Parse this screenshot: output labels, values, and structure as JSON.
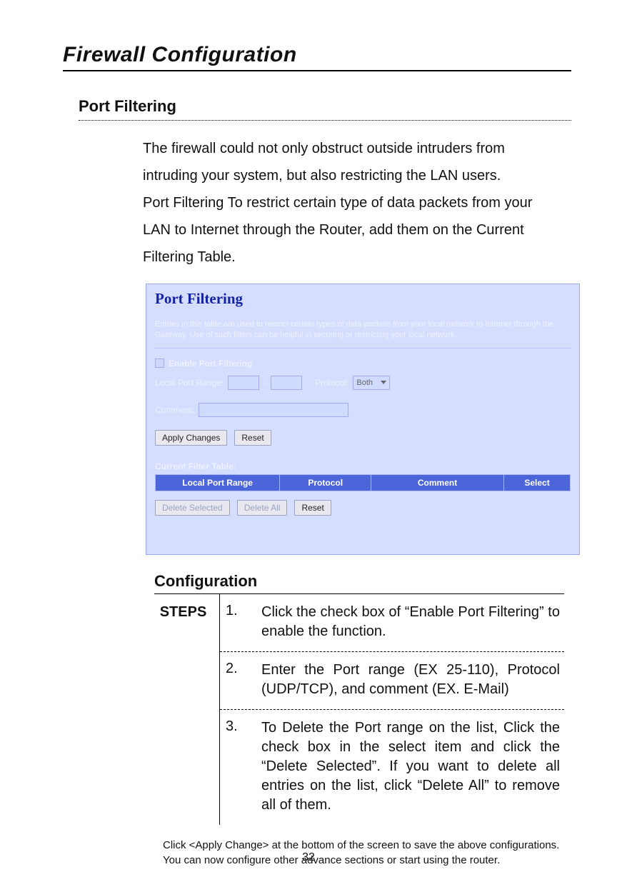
{
  "doc": {
    "title": "Firewall Configuration",
    "section": "Port Filtering",
    "paragraph1": "The firewall could not only obstruct outside intruders from intruding your system, but also restricting the LAN users.",
    "paragraph2": "Port Filtering To restrict certain type of data packets from your LAN to Internet through the Router, add them on the Current Filtering Table."
  },
  "shot": {
    "title": "Port Filtering",
    "description": "Entries in this table are used to restrict certain types of data packets from your local network to Internet through the Gateway. Use of such filters can be helpful in securing or restricting your local network.",
    "enable_label": "Enable Port Filtering",
    "port_range_label": "Local Port Range:",
    "protocol_label": "Protocol:",
    "protocol_value": "Both",
    "comment_label": "Comment:",
    "btn_apply": "Apply Changes",
    "btn_reset": "Reset",
    "table_title": "Current Filter Table:",
    "th1": "Local Port Range",
    "th2": "Protocol",
    "th3": "Comment",
    "th4": "Select",
    "btn_del_sel": "Delete Selected",
    "btn_del_all": "Delete All",
    "btn_reset2": "Reset"
  },
  "config": {
    "title": "Configuration",
    "steps_label": "STEPS",
    "steps": [
      {
        "num": "1.",
        "text": "Click the check box of “Enable Port Filtering” to enable the function."
      },
      {
        "num": "2.",
        "text": "Enter the Port range (EX 25-110), Protocol (UDP/TCP), and comment (EX. E-Mail)"
      },
      {
        "num": "3.",
        "text": "To Delete the Port range on the list, Click the check box in the select item and click the “Delete Selected”. If you want to delete all entries on the list, click “Delete All” to remove all of them."
      }
    ],
    "footnote": "Click <Apply Change> at the bottom of the screen to save the above configurations. You can now configure other advance sections or start using the router."
  },
  "page_number": "32"
}
